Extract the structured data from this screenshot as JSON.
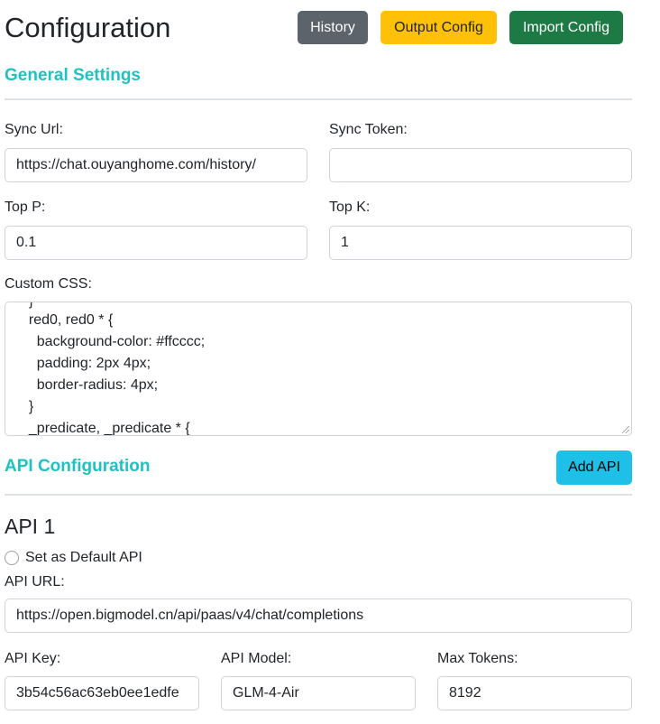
{
  "header": {
    "title": "Configuration",
    "buttons": {
      "history": "History",
      "output": "Output Config",
      "import": "Import Config"
    }
  },
  "general": {
    "heading": "General Settings",
    "sync_url": {
      "label": "Sync Url:",
      "value": "https://chat.ouyanghome.com/history/"
    },
    "sync_token": {
      "label": "Sync Token:",
      "value": ""
    },
    "top_p": {
      "label": "Top P:",
      "value": "0.1"
    },
    "top_k": {
      "label": "Top K:",
      "value": "1"
    },
    "custom_css": {
      "label": "Custom CSS:",
      "lines": [
        "  }",
        "  red0, red0 * {",
        "    background-color: #ffcccc;",
        "    padding: 2px 4px;",
        "    border-radius: 4px;",
        "  }",
        "  _predicate, _predicate * {"
      ]
    }
  },
  "api_config": {
    "heading": "API Configuration",
    "add_button": "Add API",
    "apis": [
      {
        "title": "API 1",
        "default_label": "Set as Default API",
        "url": {
          "label": "API URL:",
          "value": "https://open.bigmodel.cn/api/paas/v4/chat/completions"
        },
        "key": {
          "label": "API Key:",
          "value": "3b54c56ac63eb0ee1edfe"
        },
        "model": {
          "label": "API Model:",
          "value": "GLM-4-Air"
        },
        "max_tokens": {
          "label": "Max Tokens:",
          "value": "8192"
        }
      }
    ]
  },
  "colors": {
    "accent": "#20c1c1",
    "history_btn": "#5c636a",
    "output_btn": "#ffc107",
    "import_btn": "#1e7a45",
    "add_api_btn": "#1fc0e8"
  }
}
